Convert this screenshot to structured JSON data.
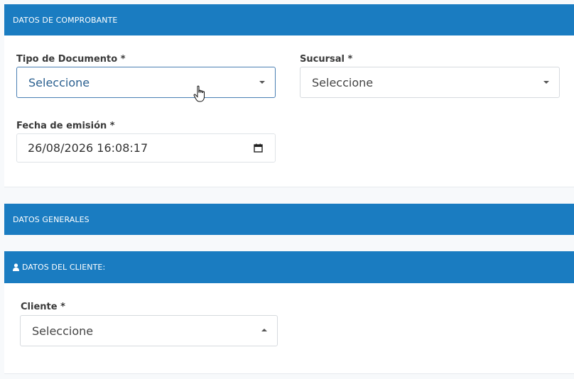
{
  "sections": {
    "comprobante": {
      "title": "DATOS DE COMPROBANTE"
    },
    "generales": {
      "title": "DATOS GENERALES"
    },
    "cliente": {
      "title": "DATOS DEL CLIENTE:",
      "icon": "user-icon"
    }
  },
  "fields": {
    "tipo_documento": {
      "label": "Tipo de Documento *",
      "value": "Seleccione"
    },
    "sucursal": {
      "label": "Sucursal *",
      "value": "Seleccione"
    },
    "fecha_emision": {
      "label": "Fecha de emisión *",
      "value": "26/08/2026 16:08:17",
      "icon": "calendar-icon"
    },
    "cliente": {
      "label": "Cliente *",
      "value": "Seleccione"
    }
  },
  "colors": {
    "section_bar": "#1a7cc1",
    "focus_border": "#4a7fb3"
  }
}
